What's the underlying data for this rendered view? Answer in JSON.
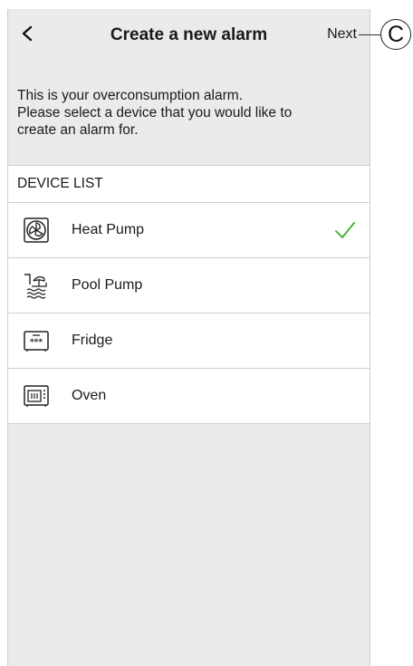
{
  "header": {
    "back_icon": "chevron-left-icon",
    "title": "Create a new alarm",
    "next_label": "Next"
  },
  "intro": {
    "lines": [
      "This is your overconsumption alarm.",
      "Please select a device that you would like to",
      "create an alarm for."
    ]
  },
  "device_list": {
    "header": "DEVICE LIST",
    "items": [
      {
        "label": "Heat Pump",
        "icon": "heat-pump-icon",
        "selected": true
      },
      {
        "label": "Pool Pump",
        "icon": "pool-pump-icon",
        "selected": false
      },
      {
        "label": "Fridge",
        "icon": "fridge-icon",
        "selected": false
      },
      {
        "label": "Oven",
        "icon": "oven-icon",
        "selected": false
      }
    ]
  },
  "annotation": {
    "callout_label": "C"
  },
  "colors": {
    "check": "#3dae2b",
    "background": "#ebebeb",
    "list_bg": "#ffffff",
    "divider": "#cfcfcf"
  }
}
